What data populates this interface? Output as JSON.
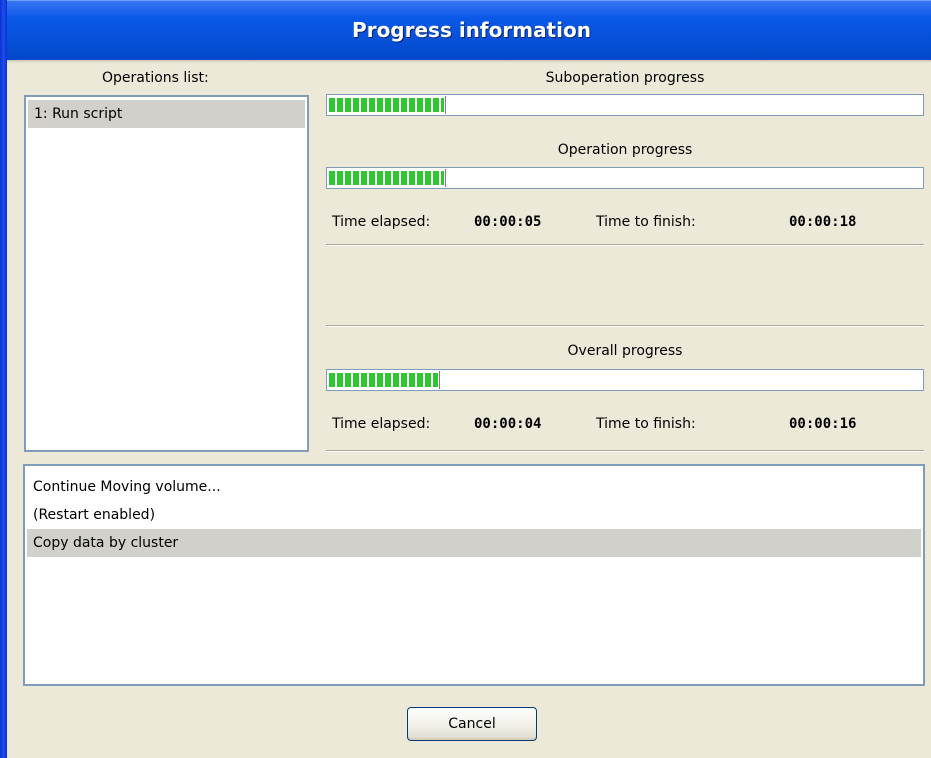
{
  "window": {
    "title": "Progress information"
  },
  "operations": {
    "heading": "Operations list:",
    "items": [
      {
        "label": "1: Run script",
        "selected": true
      }
    ]
  },
  "suboperation": {
    "heading": "Suboperation progress",
    "progress_fraction": 0.2
  },
  "operation": {
    "heading": "Operation progress",
    "progress_fraction": 0.2,
    "elapsed_label": "Time elapsed:",
    "elapsed_value": "00:00:05",
    "finish_label": "Time to finish:",
    "finish_value": "00:00:18"
  },
  "overall": {
    "heading": "Overall progress",
    "progress_fraction": 0.19,
    "elapsed_label": "Time elapsed:",
    "elapsed_value": "00:00:04",
    "finish_label": "Time to finish:",
    "finish_value": "00:00:16"
  },
  "log": {
    "lines": [
      {
        "text": "Continue Moving volume...",
        "selected": false
      },
      {
        "text": "(Restart enabled)",
        "selected": false
      },
      {
        "text": "Copy data by cluster",
        "selected": true
      }
    ]
  },
  "buttons": {
    "cancel_label": "Cancel"
  },
  "colors": {
    "title_bar": "#0550d6",
    "progress_segment": "#2fc72f",
    "window_background": "#ece9d8",
    "selection": "#d2d0cb"
  }
}
